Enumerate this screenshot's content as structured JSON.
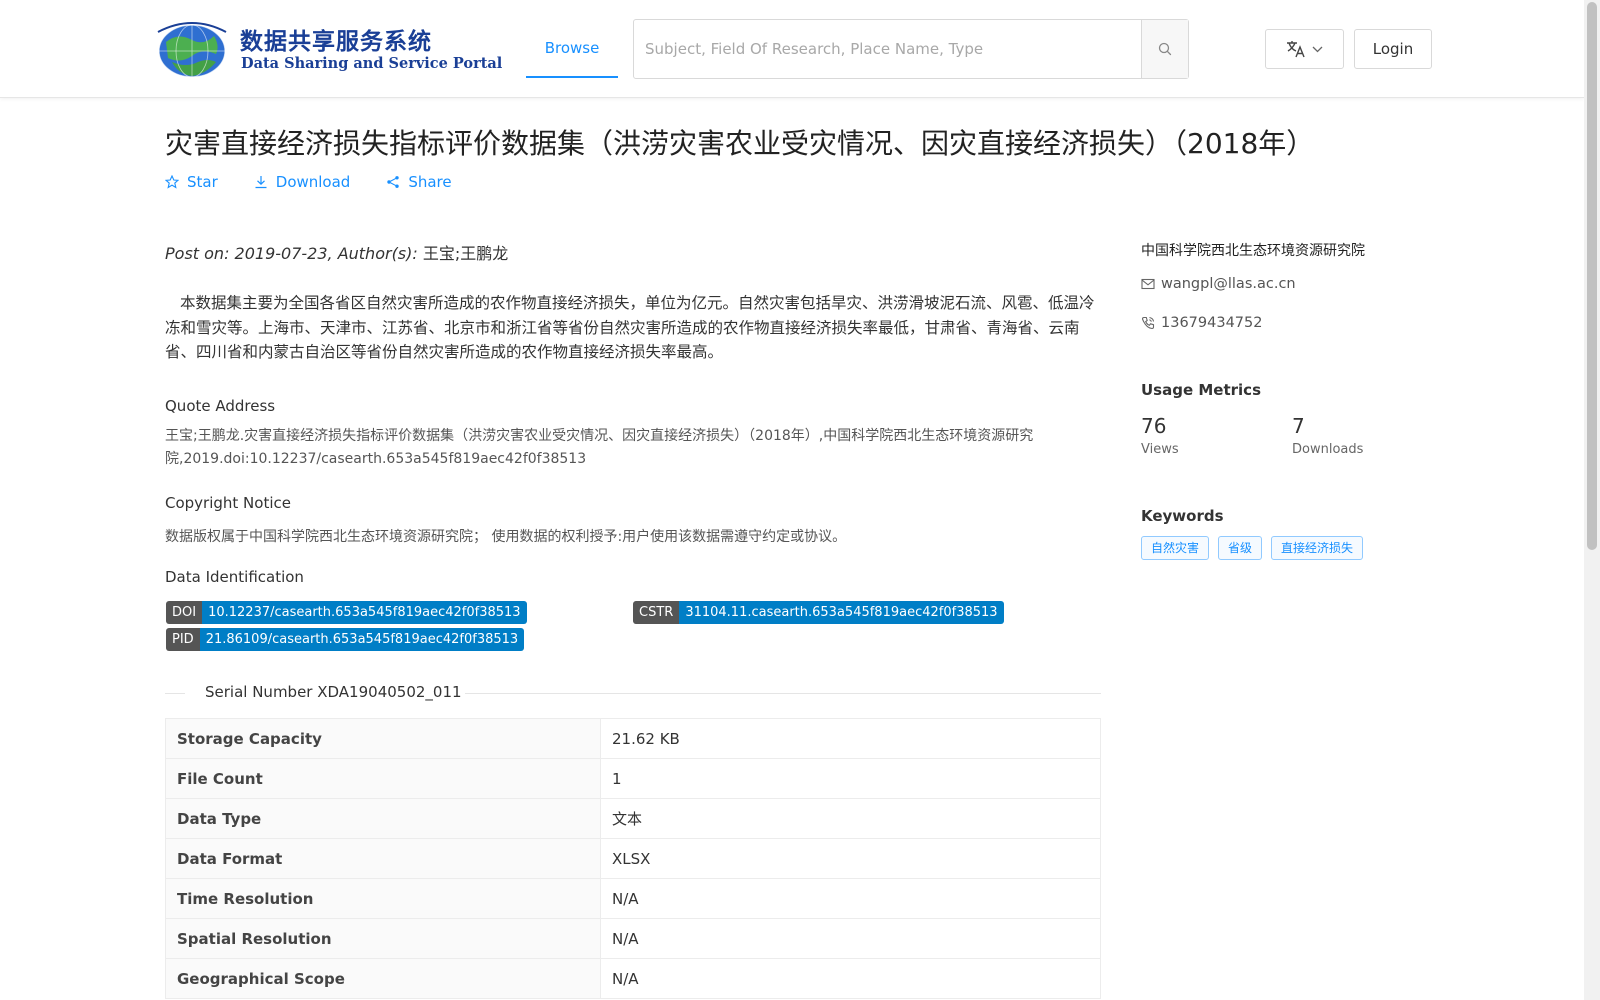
{
  "header": {
    "logo_cn": "数据共享服务系统",
    "logo_en": "Data Sharing and Service Portal",
    "nav_browse": "Browse",
    "search_placeholder": "Subject, Field Of Research, Place Name, Type",
    "login_label": "Login"
  },
  "dataset": {
    "title": "灾害直接经济损失指标评价数据集（洪涝灾害农业受灾情况、因灾直接经济损失）（2018年）",
    "actions": {
      "star": "Star",
      "download": "Download",
      "share": "Share"
    },
    "post_prefix": "Post on: 2019-07-23, Author(s): ",
    "authors": "王宝;王鹏龙",
    "abstract": "本数据集主要为全国各省区自然灾害所造成的农作物直接经济损失，单位为亿元。自然灾害包括旱灾、洪涝滑坡泥石流、风雹、低温冷冻和雪灾等。上海市、天津市、江苏省、北京市和浙江省等省份自然灾害所造成的农作物直接经济损失率最低，甘肃省、青海省、云南省、四川省和内蒙古自治区等省份自然灾害所造成的农作物直接经济损失率最高。",
    "quote_label": "Quote Address",
    "quote_text": "王宝;王鹏龙.灾害直接经济损失指标评价数据集（洪涝灾害农业受灾情况、因灾直接经济损失）（2018年）,中国科学院西北生态环境资源研究院,2019.doi:10.12237/casearth.653a545f819aec42f0f38513",
    "copyright_label": "Copyright Notice",
    "copyright_text": "数据版权属于中国科学院西北生态环境资源研究院； 使用数据的权利授予:用户使用该数据需遵守约定或协议。",
    "identification_label": "Data Identification",
    "identifiers": {
      "doi_key": "DOI",
      "doi_value": "10.12237/casearth.653a545f819aec42f0f38513",
      "cstr_key": "CSTR",
      "cstr_value": "31104.11.casearth.653a545f819aec42f0f38513",
      "pid_key": "PID",
      "pid_value": "21.86109/casearth.653a545f819aec42f0f38513"
    },
    "serial_number": "Serial Number XDA19040502_011",
    "table": [
      {
        "key": "Storage Capacity",
        "value": "21.62 KB"
      },
      {
        "key": "File Count",
        "value": "1"
      },
      {
        "key": "Data Type",
        "value": "文本"
      },
      {
        "key": "Data Format",
        "value": "XLSX"
      },
      {
        "key": "Time Resolution",
        "value": "N/A"
      },
      {
        "key": "Spatial Resolution",
        "value": "N/A"
      },
      {
        "key": "Geographical Scope",
        "value": "N/A"
      }
    ]
  },
  "sidebar": {
    "organization": "中国科学院西北生态环境资源研究院",
    "email": "wangpl@llas.ac.cn",
    "phone": "13679434752",
    "usage_heading": "Usage Metrics",
    "views_count": "76",
    "views_label": "Views",
    "downloads_count": "7",
    "downloads_label": "Downloads",
    "keywords_heading": "Keywords",
    "keywords": [
      "自然灾害",
      "省级",
      "直接经济损失"
    ]
  },
  "colors": {
    "accent": "#1890ff",
    "badge_key": "#555555",
    "badge_value": "#007ec6",
    "logo_blue": "#1a3f96"
  },
  "icons": [
    "globe-logo-icon",
    "search-icon",
    "translate-icon",
    "chevron-down-icon",
    "star-icon",
    "download-icon",
    "share-icon",
    "mail-icon",
    "phone-icon"
  ]
}
